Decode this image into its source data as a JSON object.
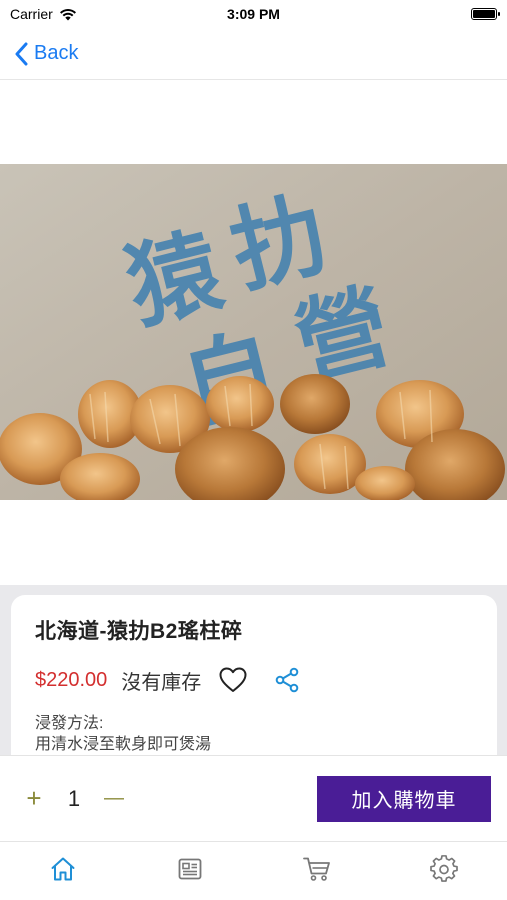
{
  "status_bar": {
    "carrier": "Carrier",
    "time": "3:09 PM"
  },
  "nav": {
    "back_label": "Back",
    "accent": "#1a7bf2"
  },
  "product": {
    "photo_stamp_text": "猿扐自營",
    "name": "北海道-猿扐B2瑤柱碎",
    "price": "$220.00",
    "stock_status": "沒有庫存",
    "description_line1": "浸發方法:",
    "description_line2": "用清水浸至軟身即可煲湯",
    "price_color": "#d32f2f"
  },
  "cart": {
    "increase_label": "+",
    "quantity": "1",
    "decrease_label": "—",
    "add_to_cart_label": "加入購物車",
    "button_color": "#4a1d96"
  },
  "tabs": [
    {
      "icon": "home-icon",
      "active": true
    },
    {
      "icon": "news-icon",
      "active": false
    },
    {
      "icon": "cart-icon",
      "active": false
    },
    {
      "icon": "gear-icon",
      "active": false
    }
  ]
}
